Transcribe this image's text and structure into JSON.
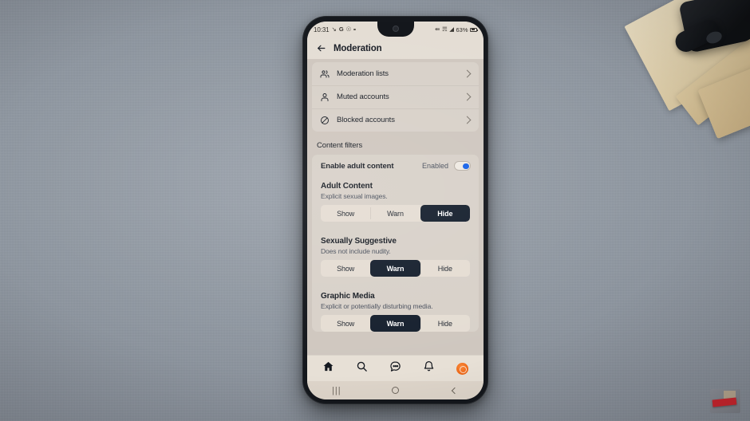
{
  "status_bar": {
    "time": "10:31",
    "icons_left": [
      "call-forward-icon",
      "google-icon",
      "alarm-icon",
      "dot-icon"
    ],
    "icons_right": [
      "share-icon",
      "wifi-icon",
      "signal-icon"
    ],
    "battery_percent": "63%"
  },
  "header": {
    "back_icon": "back-arrow-icon",
    "title": "Moderation"
  },
  "menu": {
    "items": [
      {
        "label": "Moderation lists",
        "icon": "people-icon"
      },
      {
        "label": "Muted accounts",
        "icon": "person-icon"
      },
      {
        "label": "Blocked accounts",
        "icon": "ban-icon"
      }
    ]
  },
  "content_filters": {
    "section_title": "Content filters",
    "adult_toggle": {
      "label": "Enable adult content",
      "state_text": "Enabled",
      "enabled": true,
      "accent_color": "#1763e8"
    },
    "filters": [
      {
        "name": "Adult Content",
        "description": "Explicit sexual images.",
        "options": [
          "Show",
          "Warn",
          "Hide"
        ],
        "selected": "Hide"
      },
      {
        "name": "Sexually Suggestive",
        "description": "Does not include nudity.",
        "options": [
          "Show",
          "Warn",
          "Hide"
        ],
        "selected": "Warn"
      },
      {
        "name": "Graphic Media",
        "description": "Explicit or potentially disturbing media.",
        "options": [
          "Show",
          "Warn",
          "Hide"
        ],
        "selected": "Warn"
      }
    ]
  },
  "bottom_nav": {
    "items": [
      {
        "icon": "home-icon",
        "active": true
      },
      {
        "icon": "search-icon",
        "active": false
      },
      {
        "icon": "chat-icon",
        "active": false
      },
      {
        "icon": "bell-icon",
        "active": false
      },
      {
        "icon": "avatar-icon",
        "active": false
      }
    ]
  },
  "system_nav": {
    "recents_glyph": "|||",
    "home_icon": "circle-icon",
    "back_icon": "chevron-left-icon"
  },
  "theme": {
    "screen_bg": "#cfc7bf",
    "card_bg": "#d8d1c9",
    "header_bg": "#e4ddd4",
    "selected_segment_bg": "#16202e",
    "avatar_color": "#ef6a19"
  }
}
